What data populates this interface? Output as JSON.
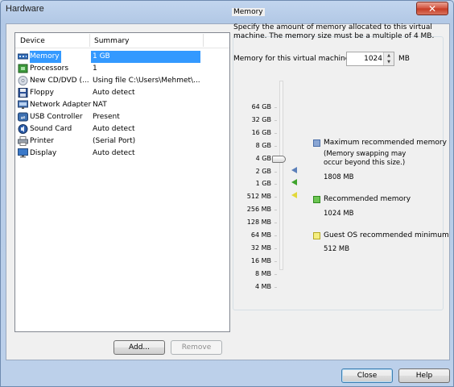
{
  "window": {
    "title": "Hardware",
    "close_glyph": "✕"
  },
  "device_list": {
    "columns": [
      "Device",
      "Summary"
    ],
    "rows": [
      {
        "name": "Memory",
        "summary": "1 GB",
        "icon": "memory-icon",
        "selected": true
      },
      {
        "name": "Processors",
        "summary": "1",
        "icon": "processor-icon"
      },
      {
        "name": "New CD/DVD (...",
        "summary": "Using file C:\\Users\\Mehmet\\...",
        "icon": "cd-dvd-icon"
      },
      {
        "name": "Floppy",
        "summary": "Auto detect",
        "icon": "floppy-icon"
      },
      {
        "name": "Network Adapter",
        "summary": "NAT",
        "icon": "network-adapter-icon"
      },
      {
        "name": "USB Controller",
        "summary": "Present",
        "icon": "usb-icon"
      },
      {
        "name": "Sound Card",
        "summary": "Auto detect",
        "icon": "sound-card-icon"
      },
      {
        "name": "Printer",
        "summary": "(Serial Port)",
        "icon": "printer-icon"
      },
      {
        "name": "Display",
        "summary": "Auto detect",
        "icon": "display-icon"
      }
    ],
    "add_label": "Add...",
    "remove_label": "Remove"
  },
  "memory": {
    "group_label": "Memory",
    "description": "Specify the amount of memory allocated to this virtual machine. The memory size must be a multiple of 4 MB.",
    "field_label": "Memory for this virtual machine:",
    "value": "1024",
    "unit": "MB",
    "scale": [
      "64 GB",
      "32 GB",
      "16 GB",
      "8 GB",
      "4 GB",
      "2 GB",
      "1 GB",
      "512 MB",
      "256 MB",
      "128 MB",
      "64 MB",
      "32 MB",
      "16 MB",
      "8 MB",
      "4 MB"
    ],
    "legend": {
      "max": {
        "label": "Maximum recommended memory",
        "note_1": "(Memory swapping may",
        "note_2": "occur beyond this size.)",
        "value": "1808 MB",
        "color": "#5b7fb9"
      },
      "rec": {
        "label": "Recommended memory",
        "value": "1024 MB",
        "color": "#3fa42c"
      },
      "guest": {
        "label": "Guest OS recommended minimum",
        "value": "512 MB",
        "color": "#e2d83a"
      }
    }
  },
  "footer": {
    "close_label": "Close",
    "help_label": "Help"
  }
}
